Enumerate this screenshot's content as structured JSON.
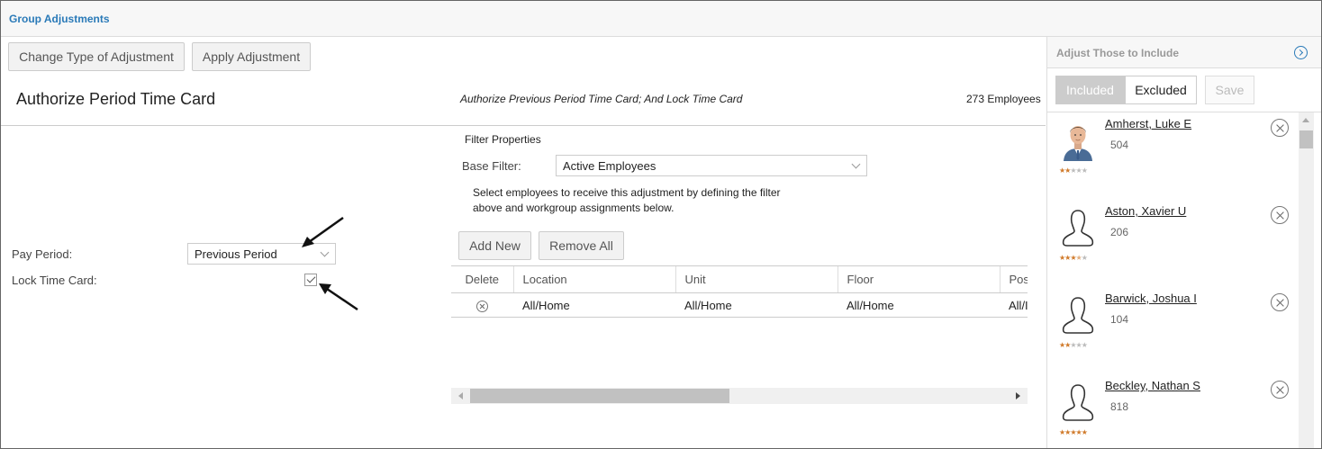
{
  "header": {
    "title": "Group Adjustments"
  },
  "toolbar": {
    "change_type": "Change Type of Adjustment",
    "apply": "Apply Adjustment"
  },
  "page": {
    "title": "Authorize Period Time Card",
    "description": "Authorize Previous Period Time Card; And Lock Time Card",
    "employee_count": "273 Employees"
  },
  "form": {
    "pay_period_label": "Pay Period:",
    "pay_period_value": "Previous Period",
    "lock_label": "Lock Time Card:",
    "lock_checked": true
  },
  "filter": {
    "title": "Filter Properties",
    "base_filter_label": "Base Filter:",
    "base_filter_value": "Active Employees",
    "help_text": "Select employees to receive this adjustment by defining the filter above and workgroup assignments below.",
    "add_new": "Add New",
    "remove_all": "Remove All"
  },
  "grid": {
    "columns": [
      "Delete",
      "Location",
      "Unit",
      "Floor",
      "Pos"
    ],
    "rows": [
      {
        "location": "All/Home",
        "unit": "All/Home",
        "floor": "All/Home",
        "pos": "All/I"
      }
    ]
  },
  "side": {
    "title": "Adjust Those to Include",
    "included": "Included",
    "excluded": "Excluded",
    "save": "Save",
    "active_tab": "Included",
    "employees": [
      {
        "name": "Amherst, Luke E",
        "number": "504",
        "rating": 2,
        "photo": true
      },
      {
        "name": "Aston, Xavier U",
        "number": "206",
        "rating": 3.5,
        "photo": false
      },
      {
        "name": "Barwick, Joshua I",
        "number": "104",
        "rating": 2,
        "photo": false
      },
      {
        "name": "Beckley, Nathan S",
        "number": "818",
        "rating": 5,
        "photo": false
      }
    ]
  },
  "colors": {
    "accent": "#2a7ab8",
    "star": "#d07a2a"
  }
}
